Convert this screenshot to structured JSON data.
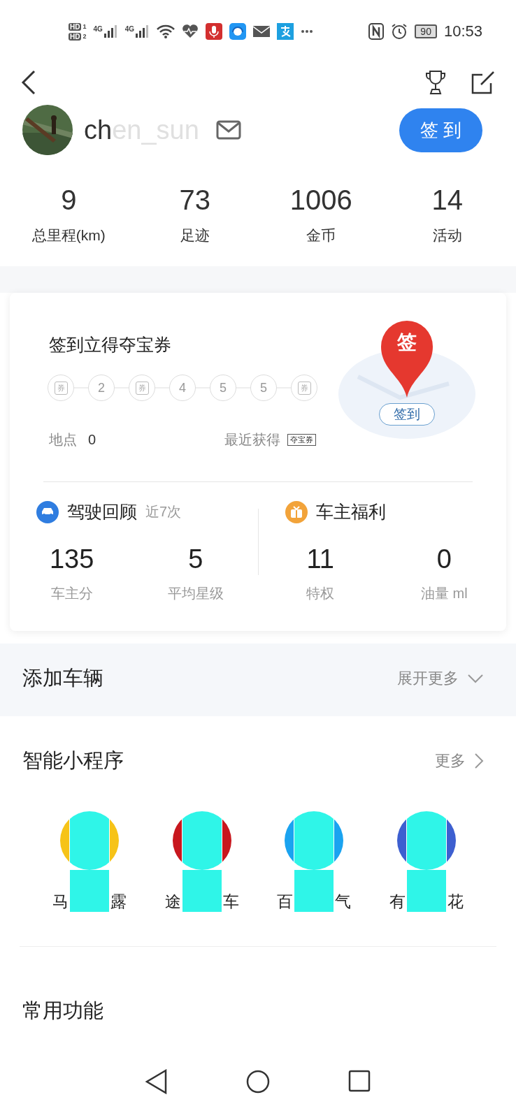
{
  "status_bar": {
    "sim_badges": [
      {
        "label": "HD",
        "slot": "1"
      },
      {
        "label": "HD",
        "slot": "2"
      }
    ],
    "networks": [
      "4G",
      "4G"
    ],
    "battery": "90",
    "time": "10:53"
  },
  "profile": {
    "name_clear": "ch",
    "name_faded": "en_sun",
    "checkin_button": "签 到"
  },
  "stats": [
    {
      "value": "9",
      "label": "总里程(km)"
    },
    {
      "value": "73",
      "label": "足迹"
    },
    {
      "value": "1006",
      "label": "金币"
    },
    {
      "value": "14",
      "label": "活动"
    }
  ],
  "checkin_card": {
    "title": "签到立得夺宝券",
    "steps": [
      {
        "kind": "ticket",
        "text": "券"
      },
      {
        "kind": "number",
        "text": "2"
      },
      {
        "kind": "ticket",
        "text": "券"
      },
      {
        "kind": "number",
        "text": "4"
      },
      {
        "kind": "number",
        "text": "5"
      },
      {
        "kind": "number",
        "text": "5"
      },
      {
        "kind": "ticket",
        "text": "券"
      }
    ],
    "place_label": "地点",
    "place_value": "0",
    "recent_label": "最近获得",
    "recent_tag": "夺宝券",
    "pin_text": "签",
    "pin_button": "签到"
  },
  "drive_review": {
    "title": "驾驶回顾",
    "subtitle": "近7次",
    "items": [
      {
        "value": "135",
        "label": "车主分"
      },
      {
        "value": "5",
        "label": "平均星级"
      }
    ]
  },
  "owner_benefits": {
    "title": "车主福利",
    "items": [
      {
        "value": "11",
        "label": "特权"
      },
      {
        "value": "0",
        "label": "油量 ml"
      }
    ]
  },
  "add_vehicle": {
    "title": "添加车辆",
    "more": "展开更多"
  },
  "mini_programs": {
    "title": "智能小程序",
    "more": "更多",
    "items": [
      {
        "color": "#f6c318",
        "label_start": "马",
        "label_end": "露"
      },
      {
        "color": "#c8171e",
        "label_start": "途",
        "label_end": "车"
      },
      {
        "color": "#1aa3f0",
        "label_start": "百",
        "label_end": "气"
      },
      {
        "color": "#3d5fd0",
        "label_start": "有",
        "label_end": "花"
      }
    ]
  },
  "common_functions": {
    "title": "常用功能"
  }
}
